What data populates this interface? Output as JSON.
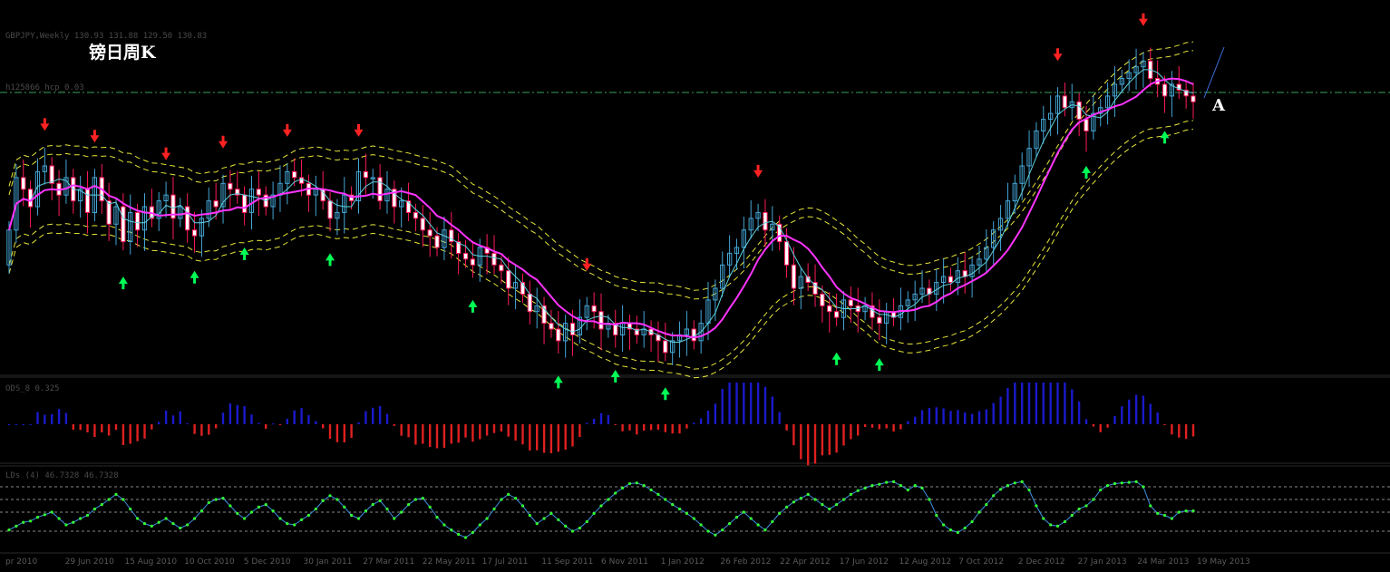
{
  "chart_data": {
    "type": "candlestick",
    "title": "镑日周K",
    "annotation_label": "A",
    "colors": {
      "background": "#000000",
      "bull_candle": "#44a6d6",
      "bear_candle": "#ff1a5a",
      "fast_ma": "#5fd0e0",
      "slow_ma": "#ff33ff",
      "envelope": "#e6e63a",
      "hline": "#3aa05a",
      "histogram_pos": "#1a1acc",
      "histogram_neg": "#e02020",
      "oscillator_line": "#3f8fe0",
      "oscillator_dot": "#33ff33",
      "arrow_buy": "#00ff55",
      "arrow_sell": "#ff2222",
      "trend_line": "#3f6fe0"
    },
    "header_text": "GBPJPY,Weekly  130.93 131.88 129.50 130.83",
    "hline_label": "h125866_hcp_0.03",
    "hist_label": "ODS_8 0.325",
    "osc_label": "LDs (4) 46.7328 46.7328",
    "x_dates": [
      "pr 2010",
      "29 Jun 2010",
      "15 Aug 2010",
      "10 Oct 2010",
      "5 Dec 2010",
      "30 Jan 2011",
      "27 Mar 2011",
      "22 May 2011",
      "17 Jul 2011",
      "11 Sep 2011",
      "6 Nov 2011",
      "1 Jan 2012",
      "26 Feb 2012",
      "22 Apr 2012",
      "17 Jun 2012",
      "12 Aug 2012",
      "7 Oct 2012",
      "2 Dec 2012",
      "27 Jan 2013",
      "24 Mar 2013",
      "19 May 2013"
    ],
    "price_close": [
      124,
      133,
      131,
      128,
      134,
      135,
      132,
      130,
      133,
      129,
      131,
      127,
      133,
      129,
      125,
      128,
      122,
      127,
      124,
      128,
      126,
      129,
      130,
      126,
      128,
      124,
      123,
      126,
      129,
      128,
      132,
      131,
      130,
      127,
      131,
      130,
      128,
      130,
      132,
      134,
      133,
      132,
      130,
      131,
      129,
      126,
      127,
      130,
      129,
      134,
      133,
      133,
      129,
      131,
      128,
      129,
      127,
      126,
      124,
      123,
      121,
      124,
      122,
      120,
      119,
      118,
      121,
      120,
      118,
      117,
      114,
      115,
      113,
      110,
      111,
      108,
      107,
      105,
      108,
      106,
      109,
      111,
      110,
      107,
      108,
      106,
      108,
      107,
      106,
      107,
      106,
      105,
      103,
      105,
      106,
      107,
      105,
      108,
      112,
      114,
      118,
      120,
      121,
      124,
      126,
      127,
      124,
      125,
      122,
      118,
      114,
      116,
      115,
      113,
      111,
      110,
      109,
      112,
      111,
      110,
      111,
      109,
      108,
      110,
      109,
      111,
      112,
      113,
      114,
      113,
      115,
      116,
      115,
      117,
      116,
      118,
      119,
      121,
      124,
      126,
      129,
      132,
      135,
      138,
      141,
      143,
      144,
      147,
      145,
      146,
      143,
      141,
      144,
      145,
      147,
      149,
      150,
      151,
      152,
      153,
      150,
      149,
      147,
      149,
      148,
      147,
      146
    ],
    "osc_value": [
      22,
      28,
      34,
      36,
      42,
      46,
      50,
      40,
      30,
      34,
      40,
      45,
      55,
      62,
      70,
      78,
      70,
      55,
      40,
      32,
      28,
      34,
      40,
      32,
      25,
      30,
      40,
      52,
      65,
      70,
      72,
      60,
      48,
      40,
      50,
      58,
      62,
      52,
      40,
      32,
      30,
      38,
      45,
      55,
      68,
      76,
      70,
      58,
      45,
      40,
      52,
      62,
      68,
      55,
      40,
      50,
      62,
      70,
      72,
      58,
      42,
      30,
      22,
      15,
      10,
      18,
      30,
      40,
      55,
      70,
      78,
      72,
      60,
      45,
      32,
      40,
      48,
      38,
      28,
      20,
      25,
      35,
      48,
      60,
      70,
      80,
      88,
      95,
      96,
      92,
      85,
      78,
      70,
      62,
      55,
      48,
      40,
      30,
      20,
      14,
      22,
      32,
      42,
      50,
      40,
      30,
      22,
      35,
      48,
      58,
      66,
      72,
      78,
      70,
      62,
      55,
      62,
      70,
      78,
      84,
      88,
      92,
      94,
      97,
      98,
      92,
      85,
      92,
      88,
      70,
      45,
      30,
      22,
      18,
      25,
      35,
      50,
      62,
      76,
      86,
      92,
      96,
      98,
      85,
      60,
      40,
      30,
      28,
      35,
      45,
      55,
      60,
      70,
      85,
      92,
      95,
      96,
      97,
      98,
      90,
      60,
      48,
      45,
      40,
      50,
      52,
      52
    ]
  }
}
